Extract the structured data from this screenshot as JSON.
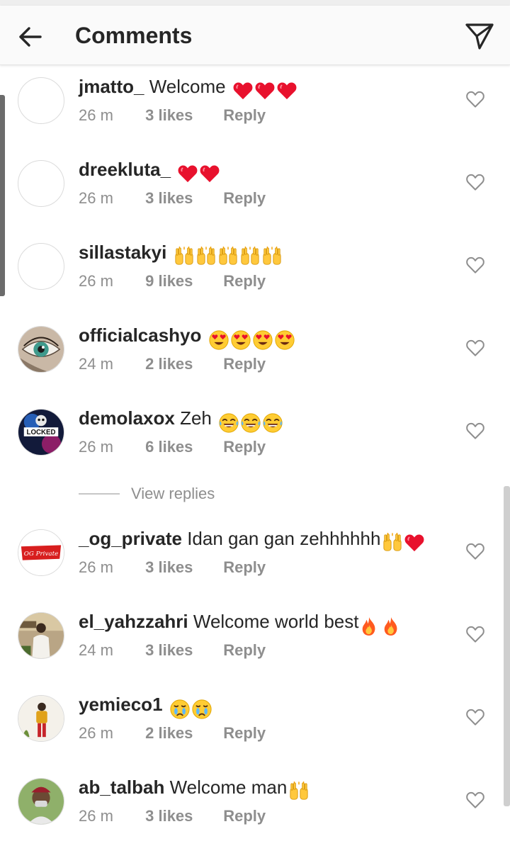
{
  "header": {
    "title": "Comments",
    "back_icon": "arrow-left-icon",
    "share_icon": "paper-plane-icon"
  },
  "colors": {
    "header_bg": "#fafafa",
    "text": "#262626",
    "meta": "#8e8e8e",
    "heart_red": "#e8112d",
    "emoji_yellow": "#ffcc33"
  },
  "comments": [
    {
      "username": "jmatto_",
      "text": "Welcome",
      "emojis": [
        "red-heart",
        "red-heart",
        "red-heart"
      ],
      "time": "26 m",
      "likes": "3 likes",
      "reply": "Reply"
    },
    {
      "username": "dreekluta_",
      "text": "",
      "emojis": [
        "red-heart",
        "red-heart"
      ],
      "time": "26 m",
      "likes": "3 likes",
      "reply": "Reply"
    },
    {
      "username": "sillastakyi",
      "text": "",
      "emojis": [
        "raising-hands",
        "raising-hands",
        "raising-hands",
        "raising-hands",
        "raising-hands"
      ],
      "time": "26 m",
      "likes": "9 likes",
      "reply": "Reply"
    },
    {
      "username": "officialcashyo",
      "text": "",
      "emojis": [
        "heart-eyes",
        "heart-eyes",
        "heart-eyes",
        "heart-eyes"
      ],
      "time": "24 m",
      "likes": "2 likes",
      "reply": "Reply"
    },
    {
      "username": "demolaxox",
      "text": "Zeh",
      "emojis": [
        "laughing-tears",
        "laughing-tears",
        "laughing-tears"
      ],
      "time": "26 m",
      "likes": "6 likes",
      "reply": "Reply"
    },
    {
      "username": "_og_private",
      "text": "Idan gan gan zehhhhhh",
      "emojis": [
        "raising-hands",
        "red-heart"
      ],
      "time": "26 m",
      "likes": "3 likes",
      "reply": "Reply"
    },
    {
      "username": "el_yahzzahri",
      "text": "Welcome world best",
      "emojis": [
        "fire",
        "fire"
      ],
      "time": "24 m",
      "likes": "3 likes",
      "reply": "Reply"
    },
    {
      "username": "yemieco1",
      "text": "",
      "emojis": [
        "crying-face",
        "crying-face"
      ],
      "time": "26 m",
      "likes": "2 likes",
      "reply": "Reply"
    },
    {
      "username": "ab_talbah",
      "text": "Welcome man",
      "emojis": [
        "raising-hands"
      ],
      "time": "26 m",
      "likes": "3 likes",
      "reply": "Reply"
    }
  ],
  "view_replies": {
    "label": "View replies"
  },
  "avatar_logo_text": {
    "demolaxox": "LOCKED",
    "og_private": "OG Private"
  }
}
